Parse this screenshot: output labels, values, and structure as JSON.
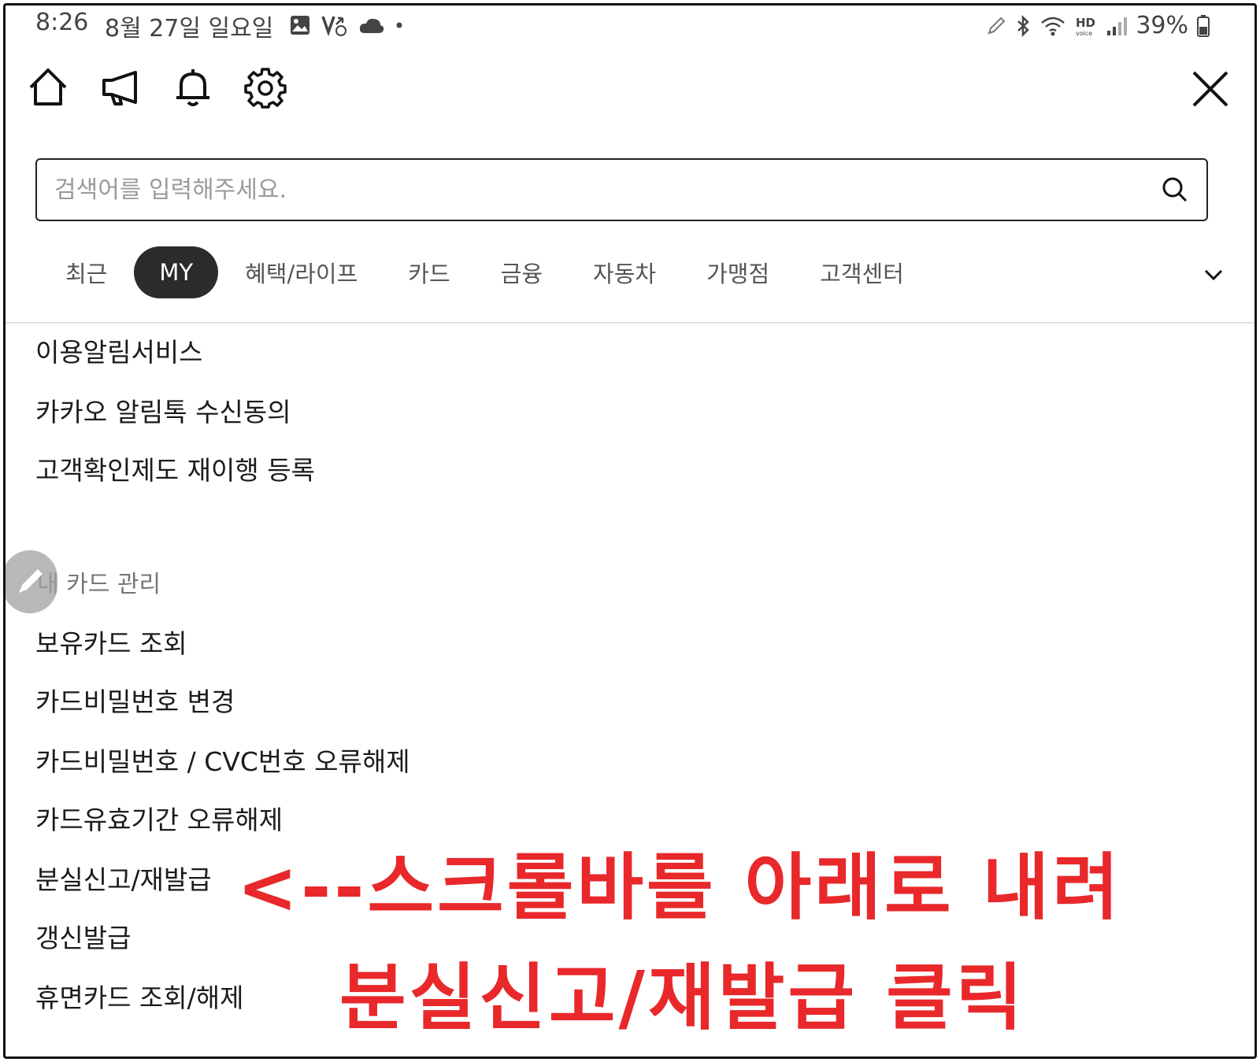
{
  "status_bar": {
    "time": "8:26",
    "date": "8월 27일 일요일",
    "battery": "39%",
    "icons_left": [
      "gallery-icon",
      "missed-call-icon",
      "cloud-icon",
      "dot-icon"
    ],
    "icons_right": [
      "pen-icon",
      "bluetooth-icon",
      "wifi-icon",
      "hd-voice-icon",
      "signal-icon",
      "battery-icon"
    ]
  },
  "top_nav": {
    "icons": [
      "home-icon",
      "megaphone-icon",
      "bell-icon",
      "gear-icon"
    ],
    "close_icon": "close-icon"
  },
  "search": {
    "placeholder": "검색어를 입력해주세요.",
    "value": ""
  },
  "tabs": [
    {
      "label": "최근",
      "active": false
    },
    {
      "label": "MY",
      "active": true
    },
    {
      "label": "혜택/라이프",
      "active": false
    },
    {
      "label": "카드",
      "active": false
    },
    {
      "label": "금융",
      "active": false
    },
    {
      "label": "자동차",
      "active": false
    },
    {
      "label": "가맹점",
      "active": false
    },
    {
      "label": "고객센터",
      "active": false
    }
  ],
  "menu_top": [
    "이용알림서비스",
    "카카오 알림톡 수신동의",
    "고객확인제도 재이행 등록"
  ],
  "card_section": {
    "title": "내 카드 관리",
    "items": [
      "보유카드 조회",
      "카드비밀번호 변경",
      "카드비밀번호 / CVC번호 오류해제",
      "카드유효기간 오류해제",
      "분실신고/재발급",
      "갱신발급",
      "휴면카드 조회/해제"
    ]
  },
  "annotation": {
    "line1": "<--스크롤바를 아래로 내려",
    "line2": "분실신고/재발급 클릭",
    "color": "#e8282a"
  }
}
